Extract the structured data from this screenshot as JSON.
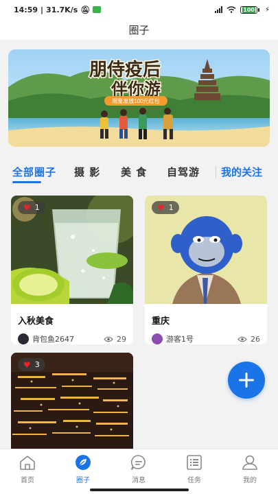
{
  "status_bar": {
    "time": "14:59",
    "network_speed": "31.7K/s",
    "battery": "100",
    "icons": [
      "mute-icon",
      "app-badge-icon",
      "signal-icon",
      "wifi-icon",
      "battery-icon",
      "charging-icon"
    ]
  },
  "header": {
    "title": "圈子"
  },
  "banner": {
    "headline_line1": "朋侍疫后",
    "headline_line2": "伴你游",
    "ribbon": "限量发放100元红包"
  },
  "tabs": [
    {
      "label": "全部圈子",
      "active": true
    },
    {
      "label": "摄 影",
      "active": false
    },
    {
      "label": "美 食",
      "active": false
    },
    {
      "label": "自驾游",
      "active": false
    },
    {
      "label": "我的关注",
      "active": false
    }
  ],
  "cards": [
    {
      "likes": "1",
      "title": "入秋美食",
      "author": "背包鱼2647",
      "views": "29"
    },
    {
      "likes": "1",
      "title": "重庆",
      "author": "游客1号",
      "views": "26"
    },
    {
      "likes": "3",
      "title": "",
      "author": "",
      "views": ""
    }
  ],
  "fab": {
    "icon": "plus-icon"
  },
  "bottom_nav": [
    {
      "label": "首页",
      "icon": "home-icon",
      "active": false
    },
    {
      "label": "圈子",
      "icon": "circle-leaf-icon",
      "active": true
    },
    {
      "label": "消息",
      "icon": "message-icon",
      "active": false
    },
    {
      "label": "任务",
      "icon": "task-icon",
      "active": false
    },
    {
      "label": "我的",
      "icon": "profile-icon",
      "active": false
    }
  ],
  "colors": {
    "accent": "#1b73e8",
    "heart": "#e8242f",
    "background": "#f2f2f2"
  }
}
